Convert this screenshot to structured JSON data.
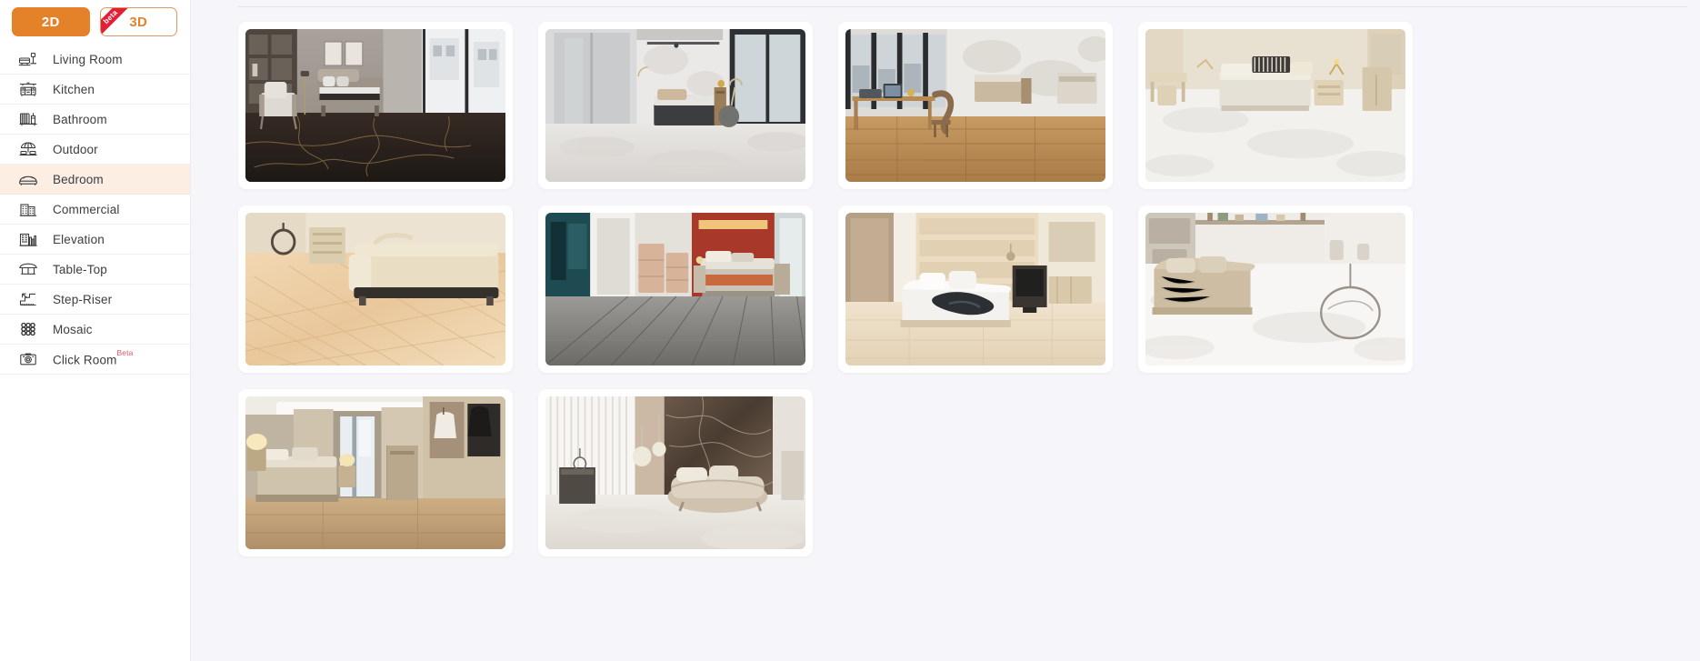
{
  "sidebar": {
    "mode_toggle": {
      "options": [
        {
          "label": "2D",
          "active": true,
          "badge": ""
        },
        {
          "label": "3D",
          "active": false,
          "badge": "beta"
        }
      ]
    },
    "items": [
      {
        "label": "Living Room",
        "icon": "sofa-icon",
        "selected": false,
        "badge": ""
      },
      {
        "label": "Kitchen",
        "icon": "kitchen-icon",
        "selected": false,
        "badge": ""
      },
      {
        "label": "Bathroom",
        "icon": "bathtub-icon",
        "selected": false,
        "badge": ""
      },
      {
        "label": "Outdoor",
        "icon": "parasol-icon",
        "selected": false,
        "badge": ""
      },
      {
        "label": "Bedroom",
        "icon": "bed-icon",
        "selected": true,
        "badge": ""
      },
      {
        "label": "Commercial",
        "icon": "building-icon",
        "selected": false,
        "badge": ""
      },
      {
        "label": "Elevation",
        "icon": "facade-icon",
        "selected": false,
        "badge": ""
      },
      {
        "label": "Table-Top",
        "icon": "table-icon",
        "selected": false,
        "badge": ""
      },
      {
        "label": "Step-Riser",
        "icon": "stairs-icon",
        "selected": false,
        "badge": ""
      },
      {
        "label": "Mosaic",
        "icon": "mosaic-icon",
        "selected": false,
        "badge": ""
      },
      {
        "label": "Click Room",
        "icon": "camera-icon",
        "selected": false,
        "badge": "Beta"
      }
    ]
  },
  "main": {
    "gallery": {
      "tiles": [
        {
          "alt": "Bedroom with dark marble floor, bookshelf wall and grey armchair",
          "scene": "dark-marble-bedroom"
        },
        {
          "alt": "Modern bedroom with white onyx floor and wardrobe",
          "scene": "white-onyx-bedroom"
        },
        {
          "alt": "Bedroom with desk, chair and honey oak wood-look floor",
          "scene": "wood-desk-bedroom"
        },
        {
          "alt": "Light beige bedroom with white terrazzo floor",
          "scene": "beige-white-bedroom"
        },
        {
          "alt": "Bedroom with beige wood-plank tile floor close-up",
          "scene": "beige-plank-bedroom"
        },
        {
          "alt": "Bedroom with red accent wall and grey plank floor",
          "scene": "red-wall-grey-floor"
        },
        {
          "alt": "Bedroom with beige textured wall and cream tile floor",
          "scene": "cream-tile-bedroom"
        },
        {
          "alt": "Cozy bedroom with shelving and white floor",
          "scene": "white-floor-shelves"
        },
        {
          "alt": "Warm lit bedroom with wardrobe and beige wood floor",
          "scene": "warm-wardrobe-bedroom"
        },
        {
          "alt": "Bedroom with dark brown marble feature wall and light floor",
          "scene": "marble-wall-bedroom"
        }
      ]
    },
    "colors": {
      "accent": "#e4822a",
      "selected_row": "#fdeee4",
      "beta_red": "#e31f35",
      "beta_sup": "#e8556a",
      "page_bg": "#f6f6fa",
      "card_bg": "#ffffff"
    }
  }
}
